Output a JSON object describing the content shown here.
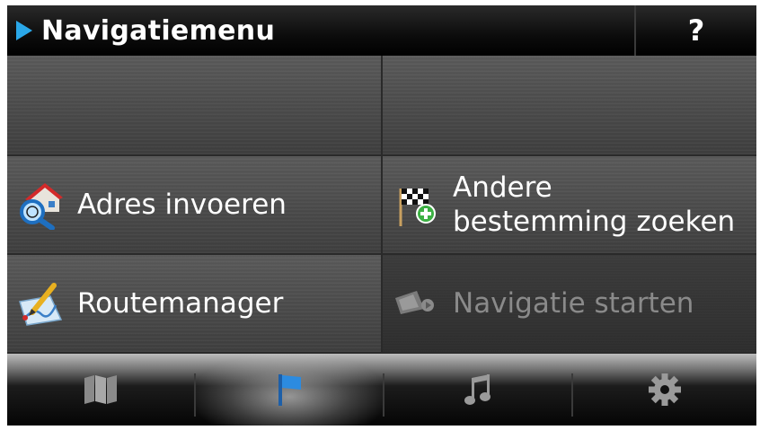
{
  "header": {
    "title": "Navigatiemenu",
    "help_label": "?"
  },
  "tiles": [
    {
      "label": "",
      "icon": "none",
      "state": "normal"
    },
    {
      "label": "",
      "icon": "none",
      "state": "normal"
    },
    {
      "label": "Adres invoeren",
      "icon": "house-magnifier-icon",
      "state": "normal"
    },
    {
      "label_lines": [
        "Andere",
        "bestemming zoeken"
      ],
      "icon": "checkered-flag-plus-icon",
      "state": "normal"
    },
    {
      "label": "Routemanager",
      "icon": "map-pencil-icon",
      "state": "normal"
    },
    {
      "label": "Navigatie starten",
      "icon": "navigation-start-icon",
      "state": "disabled"
    }
  ],
  "bottombar": {
    "items": [
      {
        "icon": "map-icon"
      },
      {
        "icon": "flag-icon",
        "active": true
      },
      {
        "icon": "music-note-icon"
      },
      {
        "icon": "gear-icon"
      }
    ]
  },
  "colors": {
    "accent": "#2aa7e8",
    "text": "#ffffff",
    "disabled_text": "#8a8a8a"
  }
}
